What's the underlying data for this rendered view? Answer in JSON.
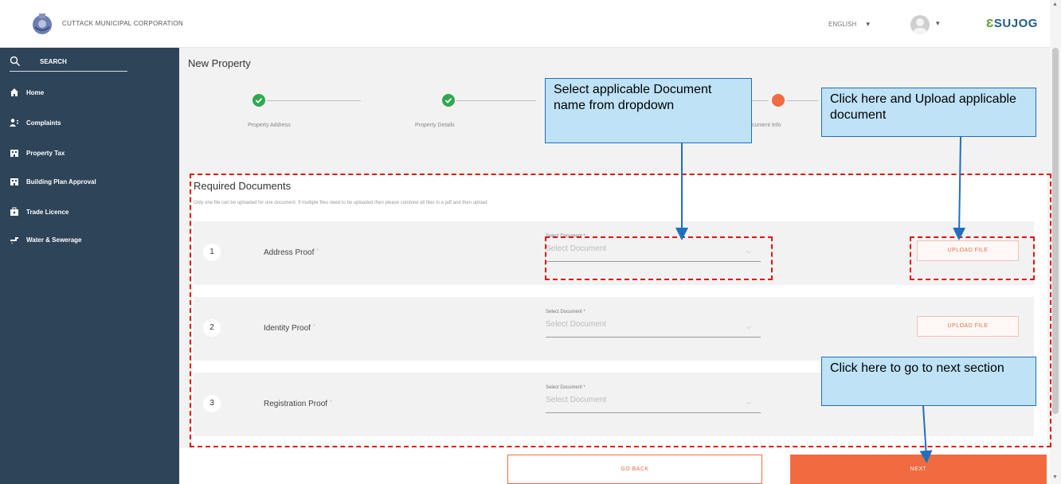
{
  "header": {
    "corporation_name": "CUTTACK MUNICIPAL CORPORATION",
    "language": "ENGLISH",
    "brand_prefix": "Ɛ",
    "brand": "SUJOG"
  },
  "sidebar": {
    "search_label": "SEARCH",
    "items": [
      {
        "label": "Home",
        "icon": "home-icon"
      },
      {
        "label": "Complaints",
        "icon": "complaints-icon"
      },
      {
        "label": "Property Tax",
        "icon": "property-tax-icon"
      },
      {
        "label": "Building Plan Approval",
        "icon": "building-plan-icon"
      },
      {
        "label": "Trade Licence",
        "icon": "trade-licence-icon"
      },
      {
        "label": "Water & Sewerage",
        "icon": "water-sewerage-icon"
      }
    ]
  },
  "main": {
    "title": "New Property",
    "steps": [
      {
        "label": "Property Address",
        "status": "done"
      },
      {
        "label": "Property Details",
        "status": "done"
      },
      {
        "label": "Document Info",
        "status": "active"
      }
    ],
    "required_title": "Required Documents",
    "required_note": "Only one file can be uploaded for one document. If multiple files need to be uploaded then please combine all files in a pdf and then upload",
    "documents": [
      {
        "number": "1",
        "name": "Address Proof",
        "required_mark": "*",
        "select_label": "Select Document *",
        "select_placeholder": "Select Document",
        "upload_label": "UPLOAD FILE"
      },
      {
        "number": "2",
        "name": "Identity Proof",
        "required_mark": "*",
        "select_label": "Select Document *",
        "select_placeholder": "Select Document",
        "upload_label": "UPLOAD FILE"
      },
      {
        "number": "3",
        "name": "Registration Proof",
        "required_mark": "*",
        "select_label": "Select Document *",
        "select_placeholder": "Select Document",
        "upload_label": ""
      }
    ],
    "go_back_label": "GO BACK",
    "next_label": "NEXT"
  },
  "annotations": {
    "select_callout": "Select applicable Document name from dropdown",
    "upload_callout": "Click here and Upload applicable document",
    "next_callout": "Click here to go to next section"
  },
  "colors": {
    "sidebar_bg": "#2e4459",
    "accent": "#f26a3f",
    "step_done": "#2fa84f",
    "callout_bg": "#bfe2f6",
    "annotation_red": "#e01414"
  }
}
